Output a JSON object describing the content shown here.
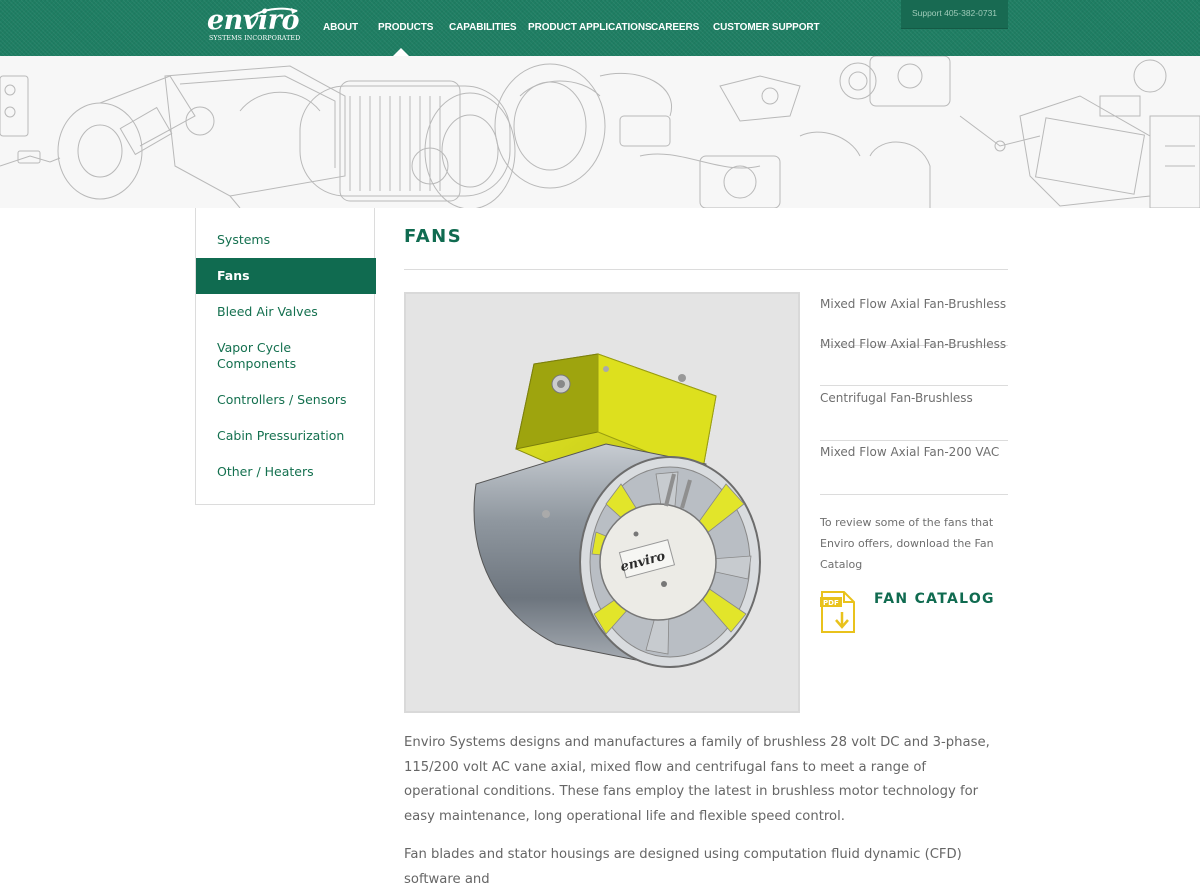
{
  "header": {
    "logo": {
      "word": "enviro",
      "sub": "SYSTEMS INCORPORATED"
    },
    "nav": [
      "ABOUT",
      "PRODUCTS",
      "CAPABILITIES",
      "PRODUCT APPLICATIONS",
      "CAREERS",
      "CUSTOMER SUPPORT"
    ],
    "active_nav": "PRODUCTS",
    "support": "Support 405-382-0731"
  },
  "sidebar": {
    "items": [
      {
        "label": "Systems"
      },
      {
        "label": "Fans"
      },
      {
        "label": "Bleed Air Valves"
      },
      {
        "label": "Vapor Cycle\nComponents"
      },
      {
        "label": "Controllers / Sensors"
      },
      {
        "label": "Cabin Pressurization"
      },
      {
        "label": "Other / Heaters"
      }
    ],
    "active": "Fans"
  },
  "main": {
    "title": "FANS",
    "product_label": "enviro",
    "fan_links": [
      "Mixed Flow Axial Fan-Brushless",
      "Mixed Flow Axial Fan-Brushless",
      "Centrifugal Fan-Brushless",
      "Mixed Flow Axial Fan-200 VAC"
    ],
    "catalog_text": "To review some of the fans that Enviro offers, download the Fan Catalog",
    "pdf_icon_label": "PDF",
    "catalog_link": "FAN CATALOG",
    "paragraphs": [
      "Enviro Systems designs and manufactures a family of brushless 28 volt DC and 3-phase, 115/200 volt AC vane axial, mixed flow and centrifugal fans  to meet a range of operational conditions. These fans employ the latest in brushless motor technology for easy maintenance, long operational life and flexible speed control.",
      "Fan blades and stator housings are designed using computation fluid dynamic (CFD) software and"
    ]
  },
  "colors": {
    "brand_green": "#106b50",
    "header_green": "#1f7e63",
    "product_yellow": "#d8dc1a"
  },
  "icons": [
    "pdf-download-icon"
  ]
}
